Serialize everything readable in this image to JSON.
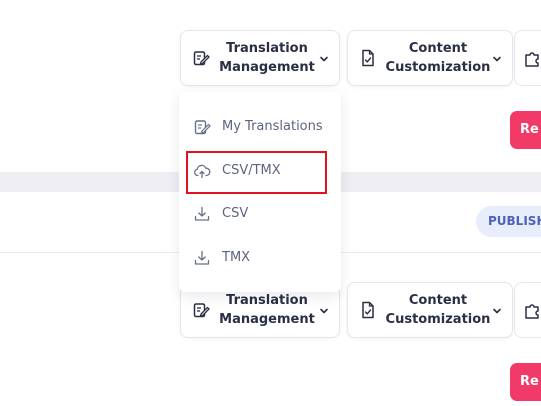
{
  "row1": {
    "translation_label": "Translation\nManagement",
    "content_label": "Content\nCustomization",
    "red_label": "Re"
  },
  "dropdown": {
    "items": [
      {
        "label": "My Translations",
        "icon": "edit-doc-icon"
      },
      {
        "label": "CSV/TMX",
        "icon": "cloud-upload-icon"
      },
      {
        "label": "CSV",
        "icon": "download-icon"
      },
      {
        "label": "TMX",
        "icon": "download-icon"
      }
    ],
    "highlighted_index": 1
  },
  "status_badge": "PUBLISH",
  "row2": {
    "translation_label": "Translation\nManagement",
    "content_label": "Content\nCustomization",
    "red_label": "Re"
  },
  "colors": {
    "accent_red": "#f23a68",
    "highlight_border": "#e0131f",
    "badge_bg": "#e7edfb",
    "badge_text": "#4d63b8",
    "section_band": "#eeeef3"
  }
}
